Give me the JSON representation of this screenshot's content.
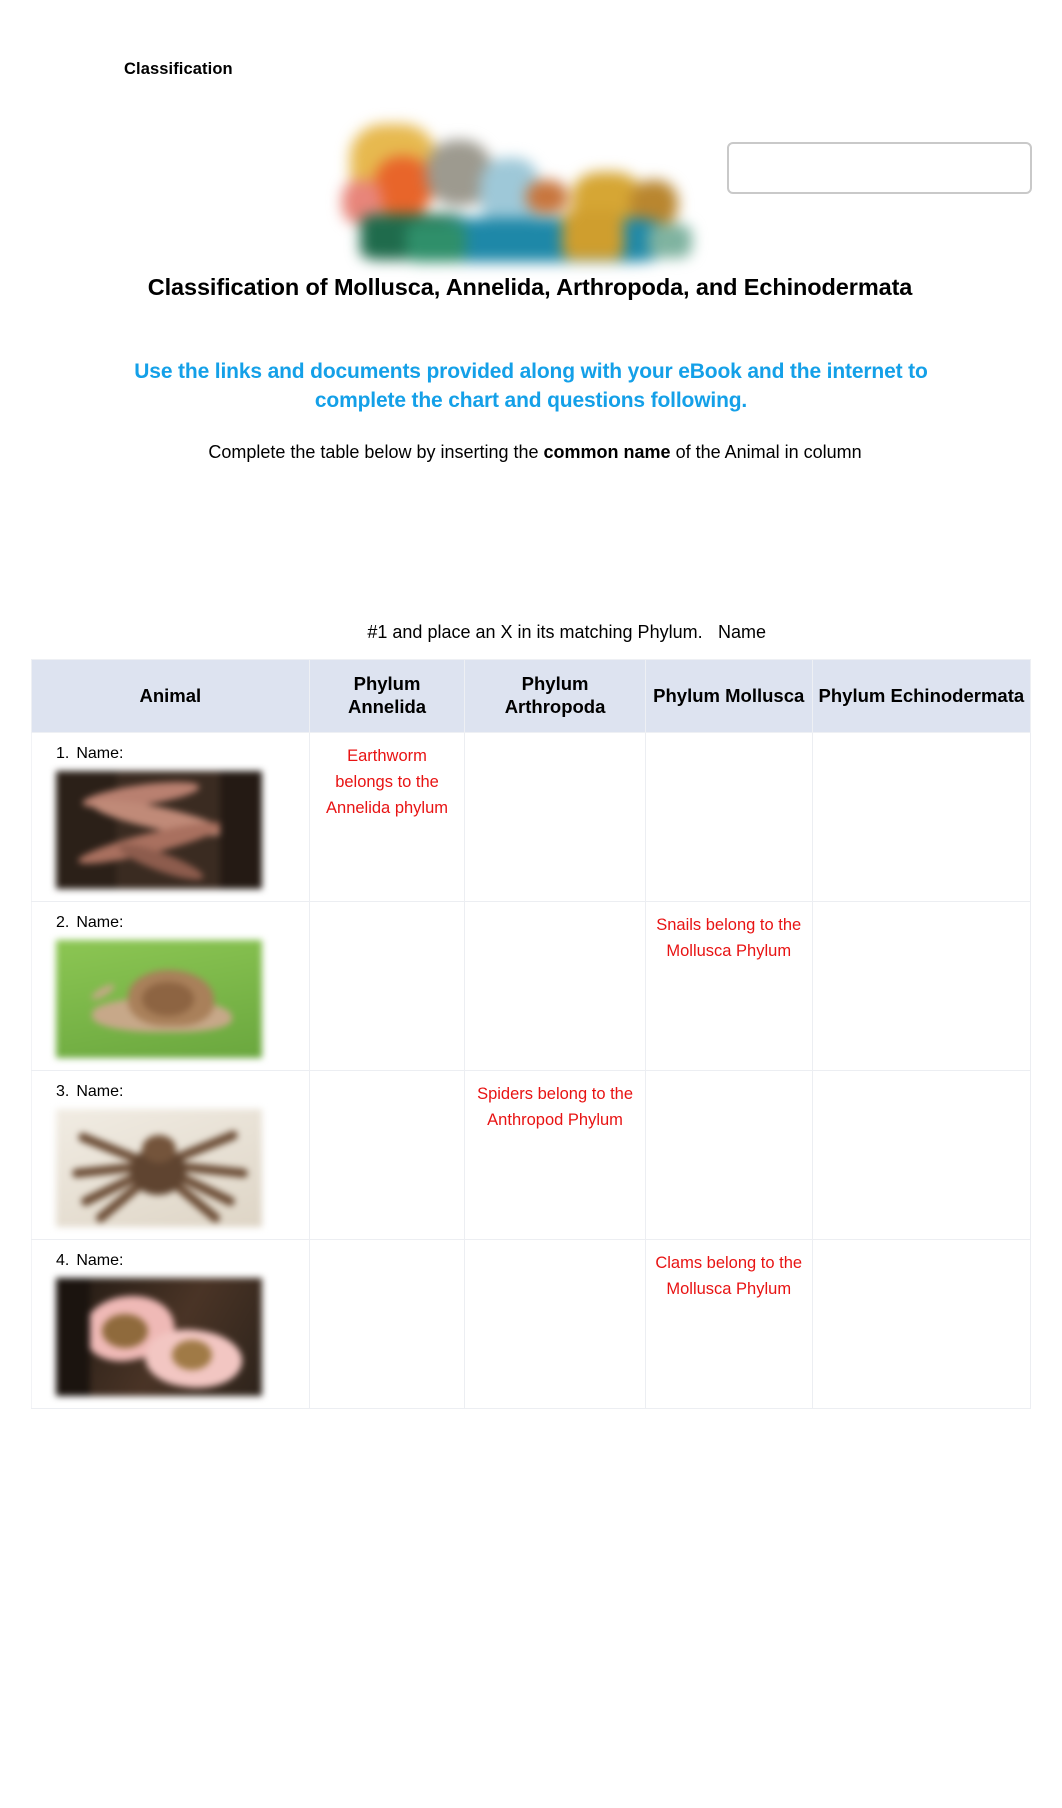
{
  "document": {
    "header_label": "Classification",
    "title": "Classification of Mollusca, Annelida, Arthropoda, and Echinodermata",
    "instruction_blue": "Use the links and documents provided along with your eBook and the internet to complete the chart and questions following.",
    "paragraph_part1": "Complete the table below by inserting the ",
    "paragraph_bold": "common name",
    "paragraph_part2": " of the Animal in column",
    "paragraph_line2": "#1 and place an X in its matching Phylum.",
    "overlapping_text": "Name",
    "name_box_value": ""
  },
  "colors": {
    "blue_instruction": "#14A0E8",
    "red_answer": "#E81313",
    "table_header_bg": "#DDE3F0",
    "table_border": "#ECEEF2"
  },
  "table": {
    "headers": [
      "Animal",
      "Phylum Annelida",
      "Phylum Arthropoda",
      "Phylum Mollusca",
      "Phylum Echinodermata"
    ],
    "rows": [
      {
        "number": "1.",
        "name_label": "Name:",
        "image": "earthworm-photo",
        "annelida": "Earthworm belongs to the Annelida phylum",
        "arthropoda": "",
        "mollusca": "",
        "echinodermata": ""
      },
      {
        "number": "2.",
        "name_label": "Name:",
        "image": "snail-photo",
        "annelida": "",
        "arthropoda": "",
        "mollusca": "Snails belong to the Mollusca Phylum",
        "echinodermata": ""
      },
      {
        "number": "3.",
        "name_label": "Name:",
        "image": "spider-photo",
        "annelida": "",
        "arthropoda": "Spiders belong to the Anthropod Phylum",
        "mollusca": "",
        "echinodermata": ""
      },
      {
        "number": "4.",
        "name_label": "Name:",
        "image": "clam-photo",
        "annelida": "",
        "arthropoda": "",
        "mollusca": "Clams belong to the Mollusca Phylum",
        "echinodermata": ""
      }
    ]
  }
}
